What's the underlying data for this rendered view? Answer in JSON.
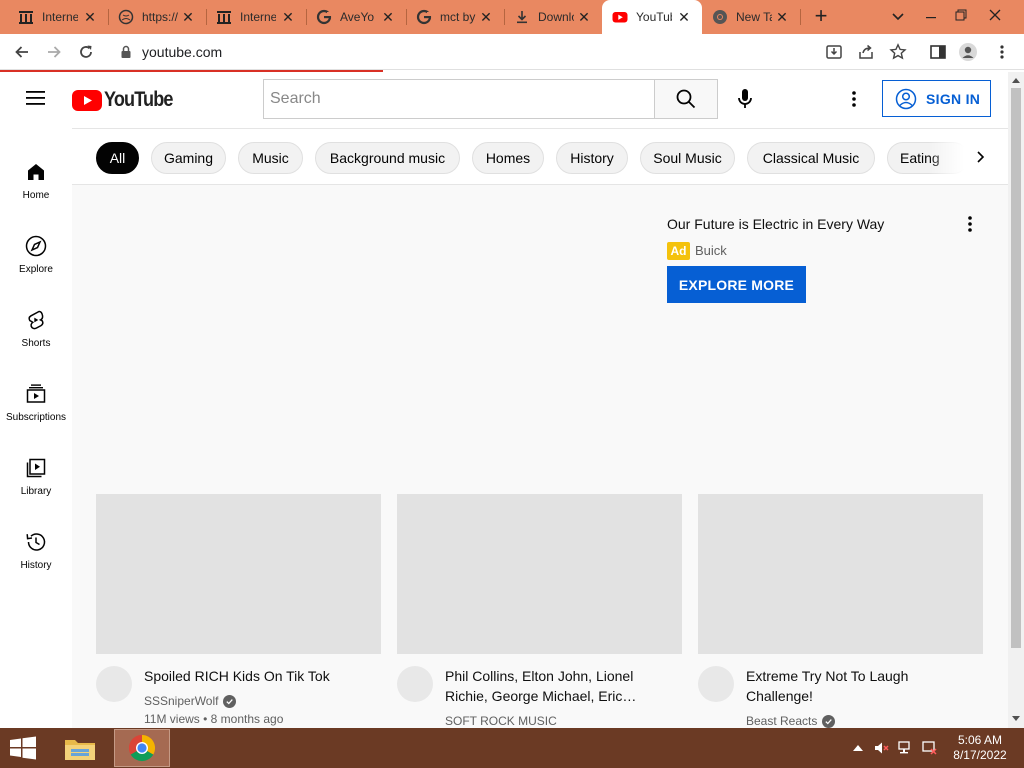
{
  "browser": {
    "tabs": [
      {
        "title": "Internet",
        "icon": "archive-icon"
      },
      {
        "title": "https://",
        "icon": "globe-icon"
      },
      {
        "title": "Internet",
        "icon": "archive-icon"
      },
      {
        "title": "AveYo",
        "icon": "google-icon"
      },
      {
        "title": "mct by",
        "icon": "google-icon"
      },
      {
        "title": "Download",
        "icon": "download-icon"
      },
      {
        "title": "YouTube",
        "icon": "youtube-icon"
      },
      {
        "title": "New Tab",
        "icon": "chrome-icon"
      }
    ],
    "active_tab": 6,
    "url": "youtube.com",
    "accent": "#e98861"
  },
  "masthead": {
    "logo_text": "YouTube",
    "search_placeholder": "Search",
    "sign_in": "SIGN IN"
  },
  "guide": [
    {
      "label": "Home",
      "icon": "home-icon"
    },
    {
      "label": "Explore",
      "icon": "compass-icon"
    },
    {
      "label": "Shorts",
      "icon": "shorts-icon"
    },
    {
      "label": "Subscriptions",
      "icon": "subscriptions-icon"
    },
    {
      "label": "Library",
      "icon": "library-icon"
    },
    {
      "label": "History",
      "icon": "history-icon"
    }
  ],
  "chips": [
    "All",
    "Gaming",
    "Music",
    "Background music",
    "Homes",
    "History",
    "Soul Music",
    "Classical Music",
    "Eating"
  ],
  "ad": {
    "title": "Our Future is Electric in Every Way",
    "badge": "Ad",
    "advertiser": "Buick",
    "cta": "EXPLORE MORE"
  },
  "videos": [
    {
      "title_line1": "Spoiled RICH Kids On Tik Tok",
      "title_line2": "",
      "channel": "SSSniperWolf",
      "verified": true,
      "meta": "11M views • 8 months ago"
    },
    {
      "title_line1": "Phil Collins, Elton John, Lionel",
      "title_line2": "Richie, George Michael, Eric…",
      "channel": "SOFT ROCK MUSIC",
      "verified": false,
      "meta": ""
    },
    {
      "title_line1": "Extreme Try Not To Laugh",
      "title_line2": "Challenge!",
      "channel": "Beast Reacts",
      "verified": true,
      "meta": ""
    }
  ],
  "taskbar": {
    "time": "5:06 AM",
    "date": "8/17/2022"
  }
}
